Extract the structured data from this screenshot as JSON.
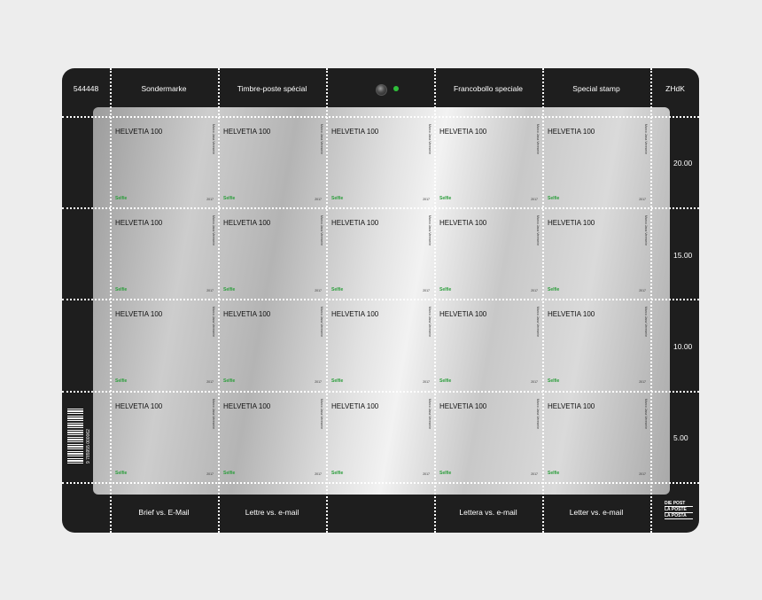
{
  "header": {
    "number": "544448",
    "de": "Sondermarke",
    "fr": "Timbre-poste spécial",
    "it": "Francobollo speciale",
    "en": "Special stamp",
    "brand": "ZHdK"
  },
  "footer": {
    "de": "Brief vs. E-Mail",
    "fr": "Lettre vs. e-mail",
    "it": "Lettera vs. e-mail",
    "en": "Letter vs. e-mail"
  },
  "stamp": {
    "title": "HELVETIA 100",
    "subtitle": "Selfie",
    "side_text": "Marco Jana Vereserie",
    "year": "2017"
  },
  "prices": [
    "20.00",
    "15.00",
    "10.00",
    "5.00"
  ],
  "barcode_number": "9 785955 000062",
  "post_logo": [
    "DIE POST",
    "LA POSTE",
    "LA POSTA"
  ],
  "colors": {
    "sheet": "#1e1e1e",
    "accent": "#2fbf3a",
    "selfie": "#2a9d3a"
  },
  "icons": [
    "camera-icon",
    "led-indicator-icon",
    "barcode-icon",
    "swiss-post-logo-icon"
  ]
}
